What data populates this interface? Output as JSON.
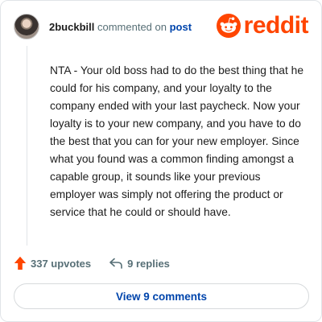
{
  "comment": {
    "username": "2buckbill",
    "commented_text": "commented on",
    "post_link": "post",
    "body": "NTA - Your old boss had to do the best thing that he could for his company, and your loyalty to the company ended with your last paycheck. Now your loyalty is to your new company, and you have to do the best that you can for your new employer. Since what you found was a common finding amongst a capable group, it sounds like your previous employer was simply not offering the product or service that he could or should have."
  },
  "brand": {
    "wordmark": "reddit",
    "color": "#ff4500"
  },
  "actions": {
    "upvotes": "337 upvotes",
    "replies": "9 replies",
    "upvote_icon": "upvote-arrow-icon",
    "reply_icon": "reply-icon"
  },
  "view_comments_label": "View 9 comments",
  "colors": {
    "link": "#0045ac",
    "muted": "#576f76",
    "upvote": "#ff4500"
  }
}
